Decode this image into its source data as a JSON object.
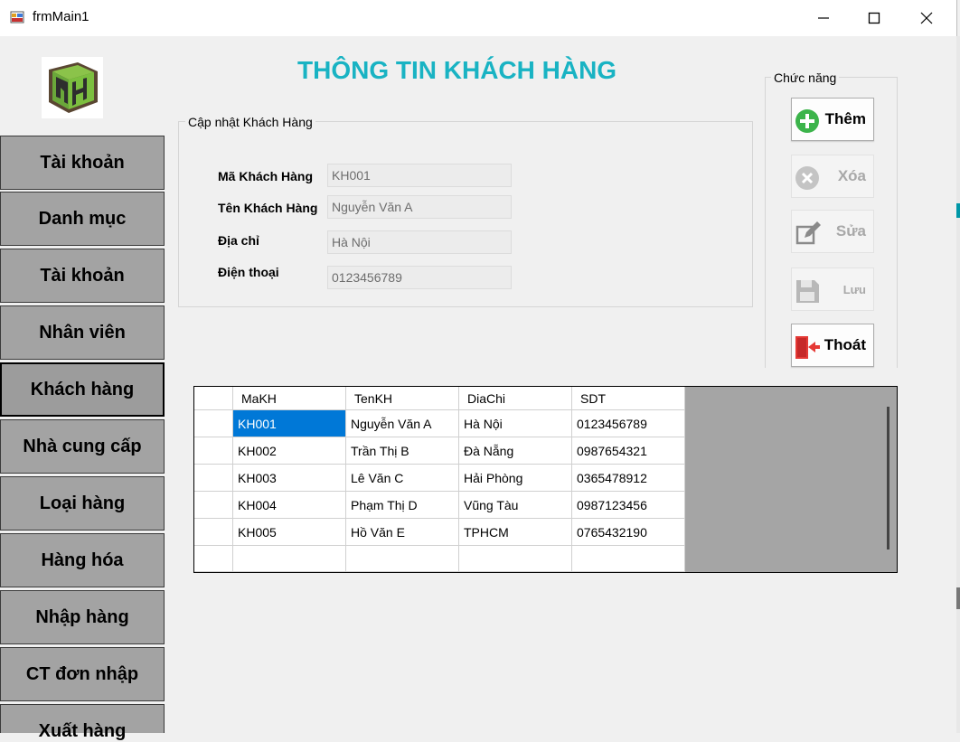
{
  "window": {
    "title": "frmMain1",
    "controls": [
      "minimize-icon",
      "maximize-icon",
      "close-icon"
    ]
  },
  "page_title": "THÔNG TIN KHÁCH HÀNG",
  "sidebar": {
    "items": [
      {
        "label": "Tài khoản"
      },
      {
        "label": "Danh mục"
      },
      {
        "label": "Tài khoản"
      },
      {
        "label": "Nhân viên"
      },
      {
        "label": "Khách hàng",
        "active": true
      },
      {
        "label": "Nhà cung cấp"
      },
      {
        "label": "Loại hàng"
      },
      {
        "label": "Hàng hóa"
      },
      {
        "label": "Nhập hàng"
      },
      {
        "label": "CT đơn nhập"
      },
      {
        "label": "Xuất hàng"
      }
    ]
  },
  "form": {
    "legend": "Cập nhật Khách Hàng",
    "fields": [
      {
        "label": "Mã Khách Hàng",
        "value": "KH001"
      },
      {
        "label": "Tên Khách Hàng",
        "value": "Nguyễn Văn A"
      },
      {
        "label": "Địa chỉ",
        "value": "Hà Nội"
      },
      {
        "label": "Điện thoại",
        "value": "0123456789"
      }
    ]
  },
  "functions": {
    "legend": "Chức năng",
    "buttons": [
      {
        "label": "Thêm",
        "icon": "plus-circle-icon",
        "enabled": true
      },
      {
        "label": "Xóa",
        "icon": "x-circle-icon",
        "enabled": false
      },
      {
        "label": "Sửa",
        "icon": "edit-icon",
        "enabled": false
      },
      {
        "label": "Lưu",
        "icon": "save-icon",
        "enabled": false
      },
      {
        "label": "Thoát",
        "icon": "exit-door-icon",
        "enabled": true
      }
    ]
  },
  "grid": {
    "columns": [
      "MaKH",
      "TenKH",
      "DiaChi",
      "SDT"
    ],
    "rows": [
      [
        "KH001",
        "Nguyễn Văn A",
        "Hà Nội",
        "0123456789"
      ],
      [
        "KH002",
        "Trần Thị B",
        "Đà Nẵng",
        "0987654321"
      ],
      [
        "KH003",
        "Lê Văn C",
        "Hải Phòng",
        "0365478912"
      ],
      [
        "KH004",
        "Phạm Thị D",
        "Vũng Tàu",
        "0987123456"
      ],
      [
        "KH005",
        "Hồ Văn E",
        "TPHCM",
        "0765432190"
      ],
      [
        "",
        "",
        "",
        ""
      ]
    ],
    "selected_cell": "KH001"
  },
  "colors": {
    "title": "#19b3c3",
    "sidebar_button": "#a3a3a3",
    "selection": "#0078d7",
    "add_icon": "#3cb44b",
    "exit_icon": "#e53935"
  }
}
